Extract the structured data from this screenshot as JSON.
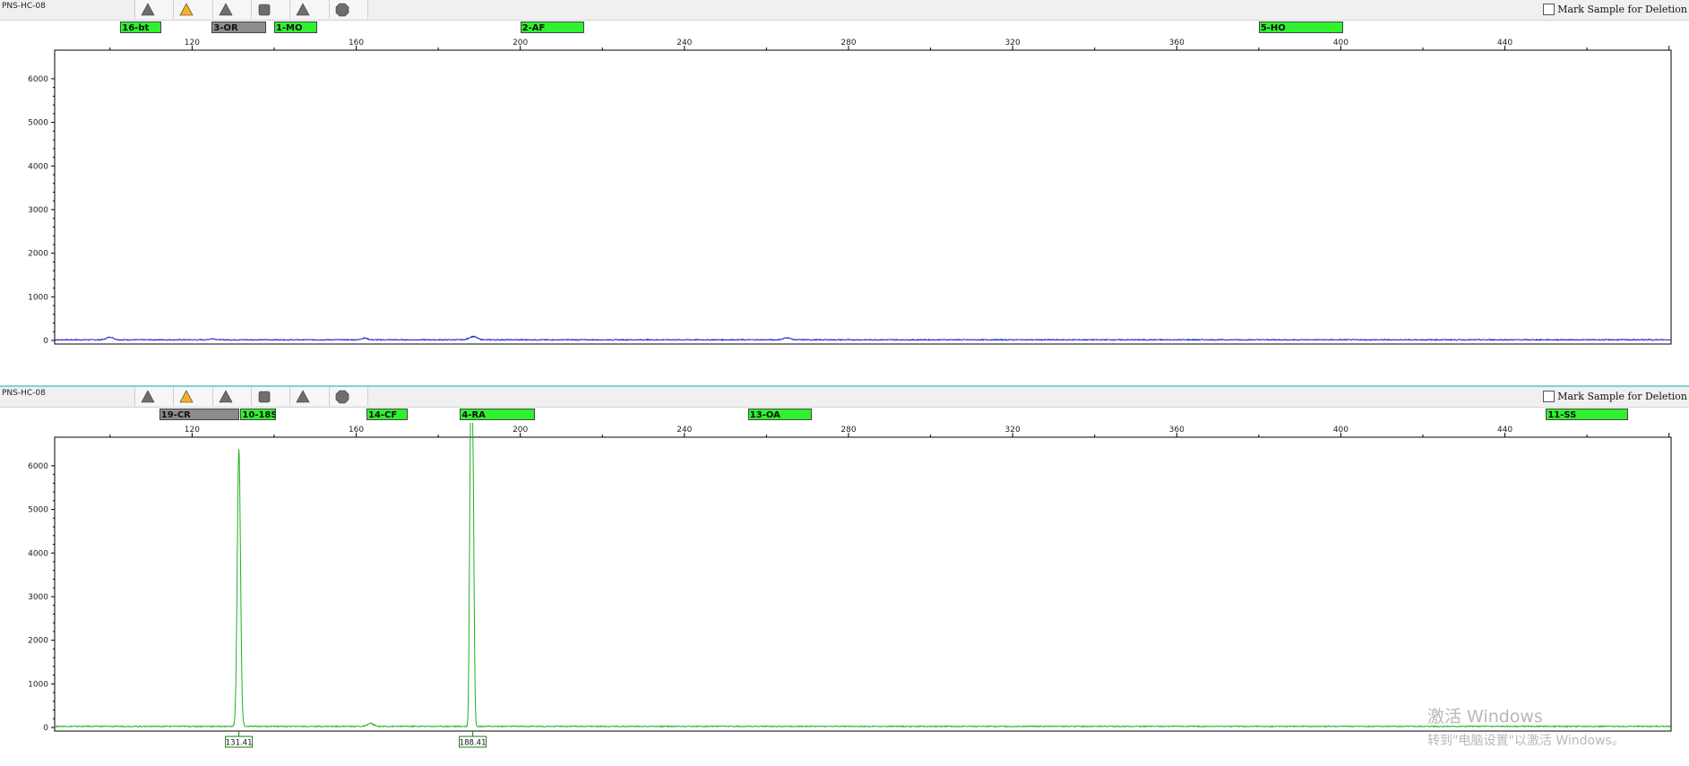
{
  "panels": [
    {
      "sample_name": "PNS-HC-08",
      "mark_label": "Mark Sample for Deletion",
      "bins": [
        {
          "label": "16-bt",
          "start": 102.5,
          "end": 112.5,
          "color": "green"
        },
        {
          "label": "3-OR",
          "start": 124.8,
          "end": 138,
          "color": "gray"
        },
        {
          "label": "1-MO",
          "start": 140,
          "end": 150.5,
          "color": "green"
        },
        {
          "label": "2-AF",
          "start": 200,
          "end": 215.5,
          "color": "green"
        },
        {
          "label": "5-HO",
          "start": 380,
          "end": 400.5,
          "color": "green"
        }
      ],
      "trace_color": "#1f1fcf",
      "chart_data": {
        "type": "line",
        "x_ticks": [
          120,
          160,
          200,
          240,
          280,
          320,
          360,
          400,
          440
        ],
        "y_ticks": [
          0,
          1000,
          2000,
          3000,
          4000,
          5000,
          6000
        ],
        "xlim": [
          86.5,
          480.5
        ],
        "ylim": [
          0,
          6450
        ],
        "baseline": 15,
        "peaks": [
          {
            "x": 100,
            "height": 60,
            "width": 1.2
          },
          {
            "x": 125,
            "height": 25,
            "width": 1.0
          },
          {
            "x": 162,
            "height": 40,
            "width": 1.0
          },
          {
            "x": 188.5,
            "height": 75,
            "width": 1.3
          },
          {
            "x": 265,
            "height": 45,
            "width": 1.2
          }
        ],
        "labeled_peaks": []
      }
    },
    {
      "sample_name": "PNS-HC-08",
      "mark_label": "Mark Sample for Deletion",
      "bins": [
        {
          "label": "19-CR",
          "start": 112,
          "end": 131.5,
          "color": "gray"
        },
        {
          "label": "10-18S",
          "start": 131.8,
          "end": 140.5,
          "color": "green"
        },
        {
          "label": "14-CF",
          "start": 162.5,
          "end": 172.5,
          "color": "green"
        },
        {
          "label": "4-RA",
          "start": 185.3,
          "end": 203.5,
          "color": "green"
        },
        {
          "label": "13-OA",
          "start": 255.5,
          "end": 271,
          "color": "green"
        },
        {
          "label": "11-SS",
          "start": 450,
          "end": 470,
          "color": "green"
        }
      ],
      "trace_color": "#20b020",
      "chart_data": {
        "type": "line",
        "x_ticks": [
          120,
          160,
          200,
          240,
          280,
          320,
          360,
          400,
          440
        ],
        "y_ticks": [
          0,
          1000,
          2000,
          3000,
          4000,
          5000,
          6000
        ],
        "xlim": [
          86.5,
          480.5
        ],
        "ylim": [
          0,
          6450
        ],
        "baseline": 25,
        "peaks": [
          {
            "x": 131.41,
            "height": 6380,
            "width": 0.55
          },
          {
            "x": 187.85,
            "height": 6050,
            "width": 0.35
          },
          {
            "x": 188.41,
            "height": 6420,
            "width": 0.4
          },
          {
            "x": 163.5,
            "height": 70,
            "width": 1.0
          }
        ],
        "labeled_peaks": [
          {
            "x": 131.41,
            "label": "131.41"
          },
          {
            "x": 188.41,
            "label": "188.41"
          }
        ]
      }
    }
  ],
  "watermark": {
    "line1": "激活 Windows",
    "line2": "转到\"电脑设置\"以激活 Windows。"
  },
  "icons": [
    "triangle-gray-icon",
    "triangle-yellow-icon",
    "triangle-gray-icon",
    "square-gray-icon",
    "triangle-gray-icon",
    "octagon-gray-icon"
  ]
}
